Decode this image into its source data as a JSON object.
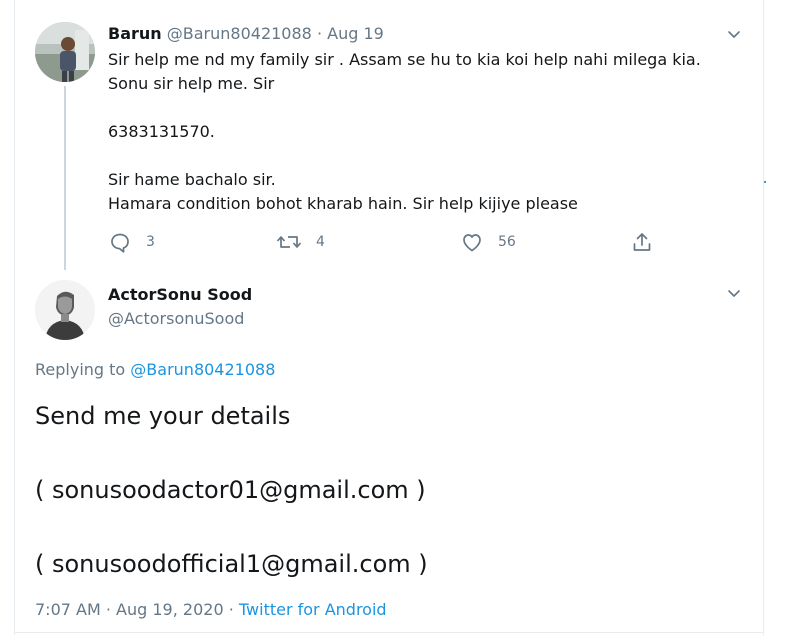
{
  "parent_tweet": {
    "author_name": "Barun",
    "author_handle": "@Barun80421088",
    "separator": "·",
    "date": "Aug 19",
    "lines": [
      "Sir help me nd my family sir . Assam se hu to kia koi help nahi milega kia.",
      "Sonu sir help me. Sir",
      "",
      "6383131570.",
      "",
      "Sir hame bachalo sir.",
      "Hamara condition bohot kharab hain. Sir help kijiye please"
    ],
    "actions": {
      "reply_count": "3",
      "retweet_count": "4",
      "like_count": "56"
    },
    "icons": [
      "chevron-down-icon",
      "reply-icon",
      "retweet-icon",
      "like-icon",
      "share-icon"
    ]
  },
  "main_tweet": {
    "author_name": "ActorSonu Sood",
    "author_handle": "@ActorsonuSood",
    "replying_prefix": "Replying to",
    "replying_handle": "@Barun80421088",
    "lines": [
      "Send me your details",
      "",
      "( sonusoodactor01@gmail.com )",
      "",
      "( sonusoodofficial1@gmail.com )"
    ],
    "time": "7:07 AM",
    "separator": "·",
    "date": "Aug 19, 2020",
    "source": "Twitter for Android"
  },
  "colors": {
    "text_primary": "#14171a",
    "text_secondary": "#657786",
    "link": "#1b95e0",
    "border": "#e6ecf0",
    "thread_line": "#ccd6dd"
  }
}
